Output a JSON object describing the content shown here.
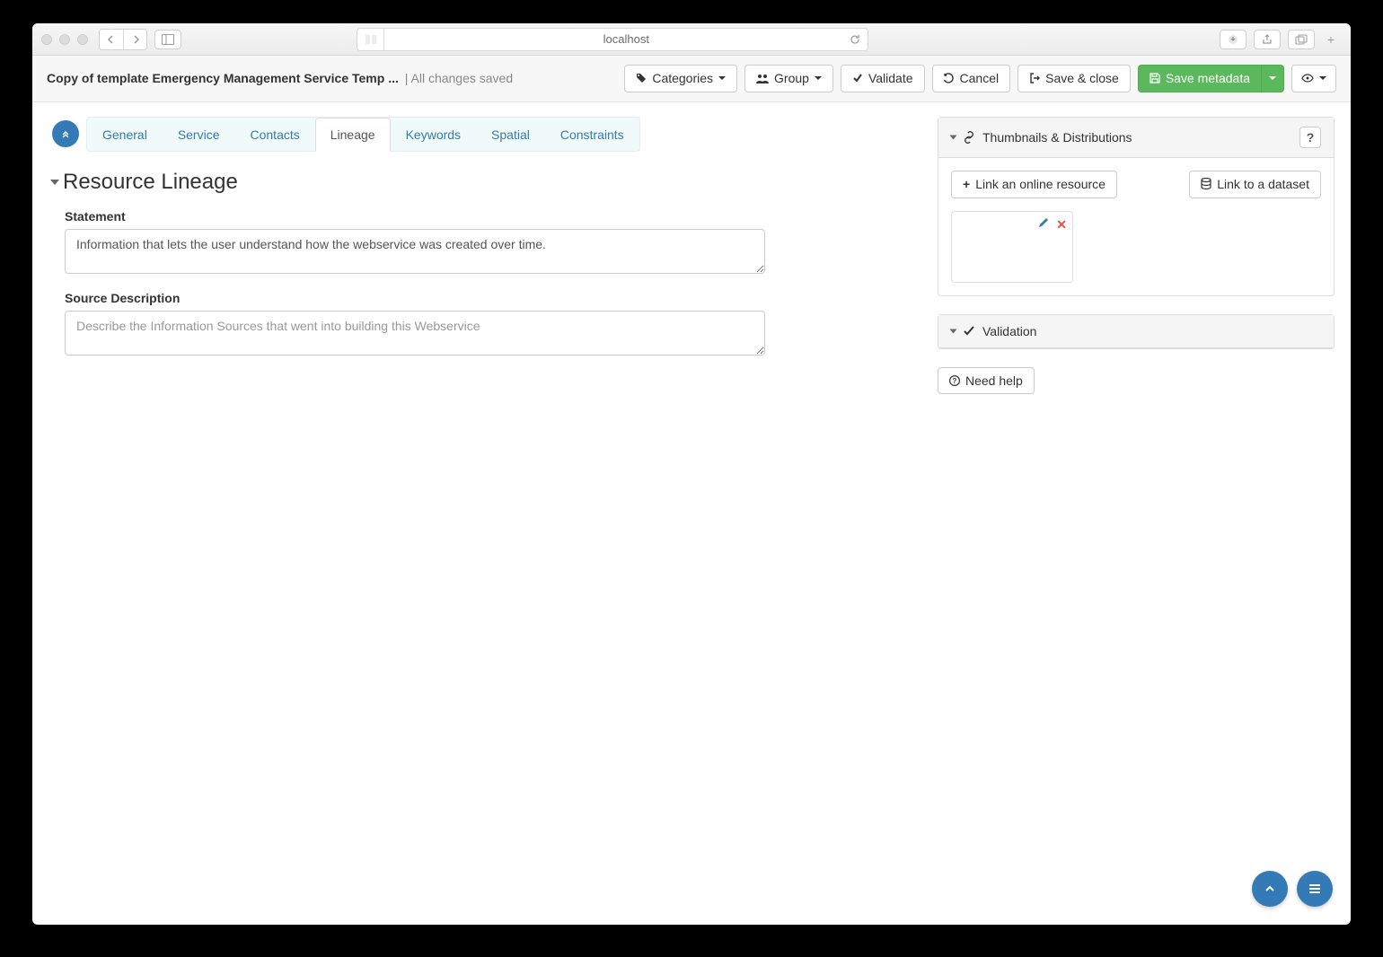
{
  "browser": {
    "address": "localhost"
  },
  "header": {
    "title": "Copy of template Emergency Management Service Temp ...",
    "savedStatus": "| All changes saved",
    "actions": {
      "categories": "Categories",
      "group": "Group",
      "validate": "Validate",
      "cancel": "Cancel",
      "saveClose": "Save & close",
      "saveMetadata": "Save metadata"
    }
  },
  "tabs": {
    "general": "General",
    "service": "Service",
    "contacts": "Contacts",
    "lineage": "Lineage",
    "keywords": "Keywords",
    "spatial": "Spatial",
    "constraints": "Constraints"
  },
  "section": {
    "heading": "Resource Lineage",
    "statement": {
      "label": "Statement",
      "value": "Information that lets the user understand how the webservice was created over time."
    },
    "sourceDescription": {
      "label": "Source Description",
      "placeholder": "Describe the Information Sources that went into building this Webservice"
    }
  },
  "sidebar": {
    "thumbPanel": {
      "title": "Thumbnails & Distributions",
      "linkOnline": "Link an online resource",
      "linkDataset": "Link to a dataset"
    },
    "validationPanel": {
      "title": "Validation"
    },
    "needHelp": "Need help"
  }
}
